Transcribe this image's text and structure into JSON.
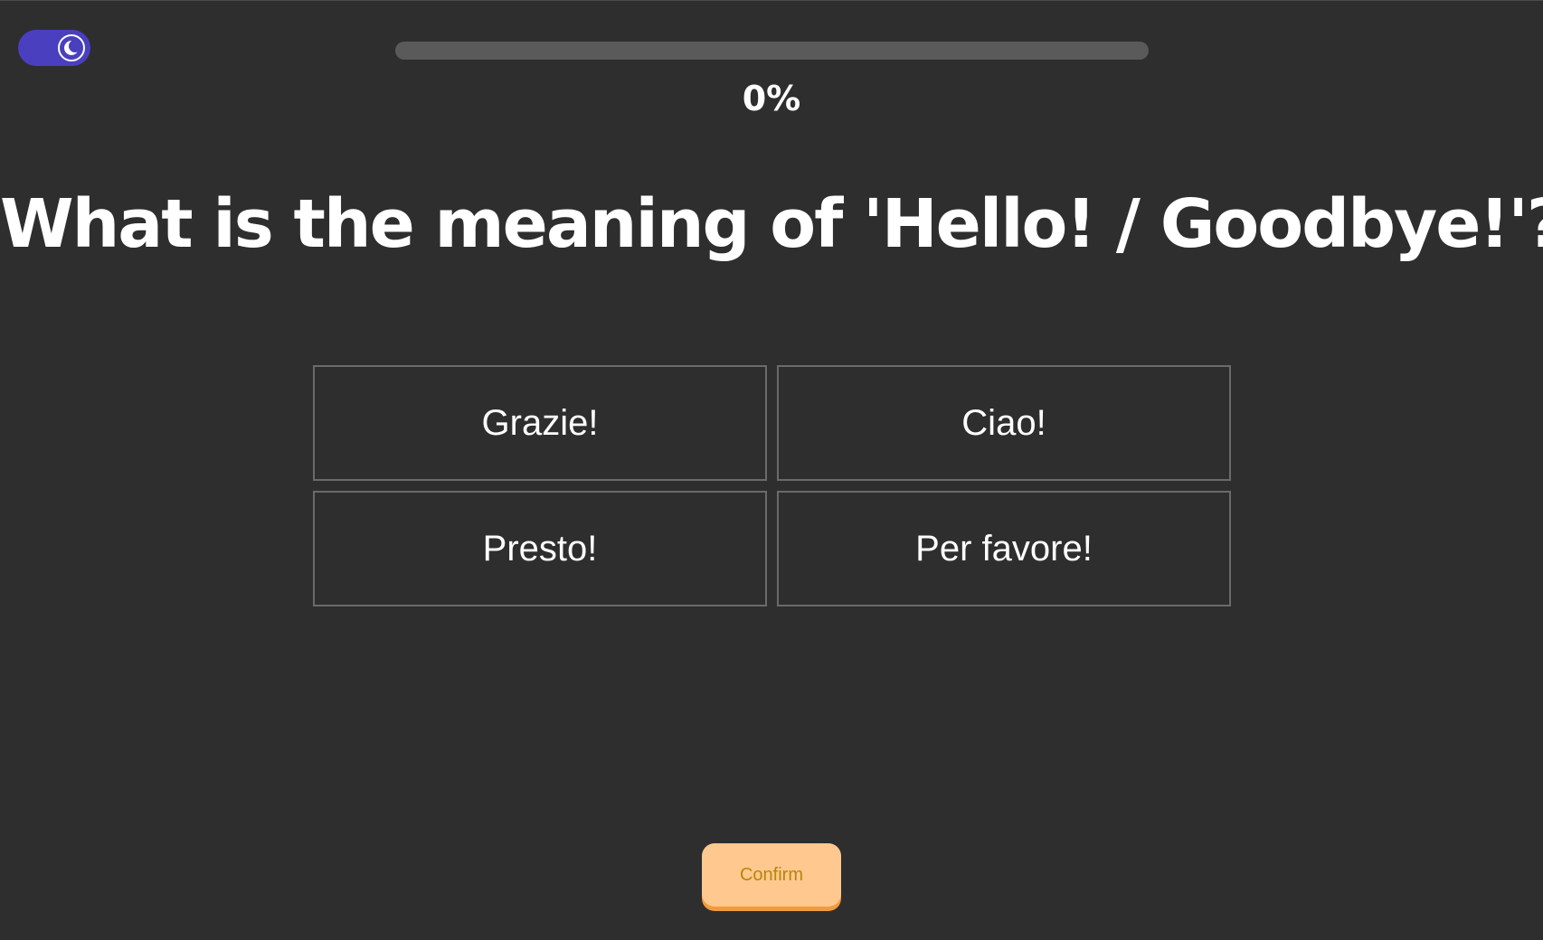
{
  "theme_toggle": {
    "state": "dark",
    "icon": "moon-icon",
    "color": "#4a3fbf"
  },
  "progress": {
    "value": 0,
    "label": "0%",
    "track_color": "#5a5a5a"
  },
  "question": {
    "text": "What is the meaning of 'Hello! / Goodbye!'?"
  },
  "options": [
    {
      "label": "Grazie!"
    },
    {
      "label": "Ciao!"
    },
    {
      "label": "Presto!"
    },
    {
      "label": "Per favore!"
    }
  ],
  "confirm": {
    "label": "Confirm",
    "color": "#ffc88f",
    "text_color": "#b8860b"
  },
  "colors": {
    "background": "#2e2e2e",
    "text": "#ffffff",
    "option_border": "#6a6a6a"
  }
}
